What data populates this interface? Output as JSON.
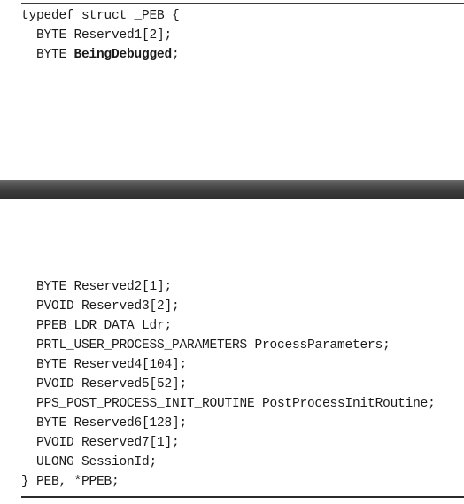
{
  "code_top": {
    "line1": "typedef struct _PEB {",
    "line2": "BYTE Reserved1[2];",
    "line3_type": "BYTE ",
    "line3_field": "BeingDebugged",
    "line3_semicolon": ";"
  },
  "code_bottom": {
    "lines": [
      "BYTE Reserved2[1];",
      "PVOID Reserved3[2];",
      "PPEB_LDR_DATA Ldr;",
      "PRTL_USER_PROCESS_PARAMETERS ProcessParameters;",
      "BYTE Reserved4[104];",
      "PVOID Reserved5[52];",
      "PPS_POST_PROCESS_INIT_ROUTINE PostProcessInitRoutine;",
      "BYTE Reserved6[128];",
      "PVOID Reserved7[1];",
      "ULONG SessionId;"
    ],
    "closing": "} PEB, *PPEB;"
  },
  "colors": {
    "text": "#1a1a1a",
    "divider": "#3d3d3d"
  }
}
